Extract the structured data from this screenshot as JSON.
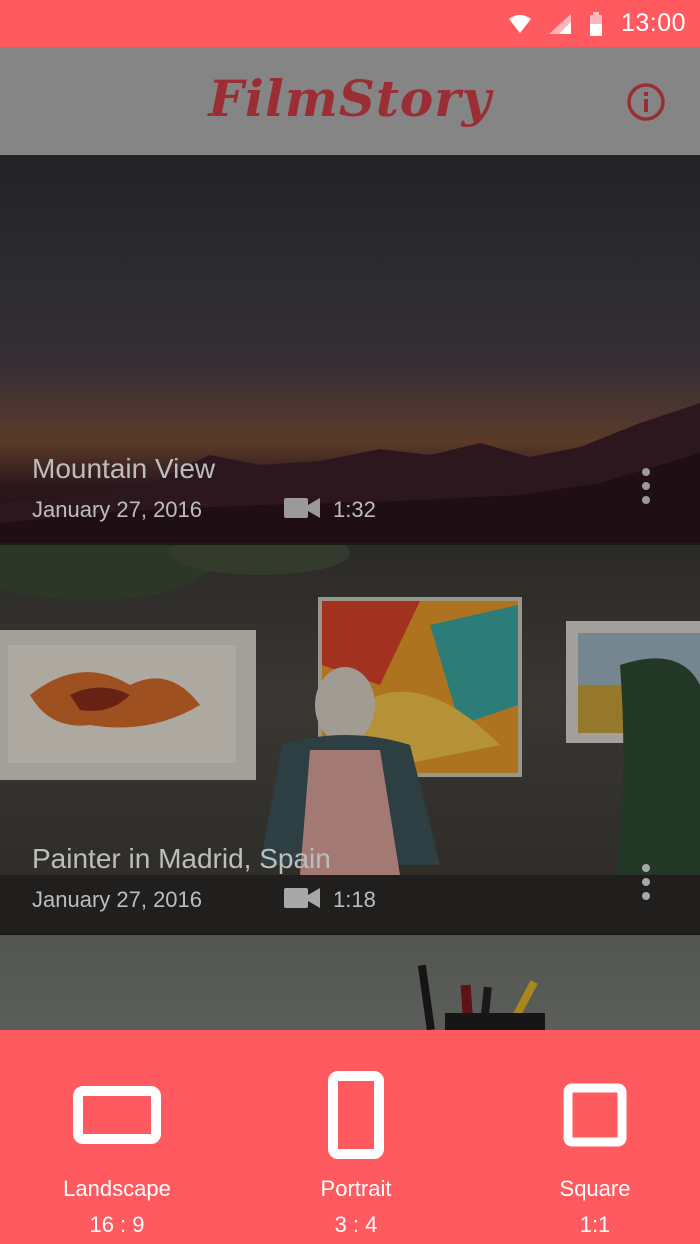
{
  "status_bar": {
    "time": "13:00"
  },
  "app_bar": {
    "title": "FilmStory",
    "info_icon": "info-icon"
  },
  "films": [
    {
      "title": "Mountain View",
      "date": "January 27, 2016",
      "duration": "1:32"
    },
    {
      "title": "Painter in Madrid, Spain",
      "date": "January 27, 2016",
      "duration": "1:18"
    }
  ],
  "formats": [
    {
      "label": "Landscape",
      "ratio": "16 : 9",
      "icon": "landscape-icon"
    },
    {
      "label": "Portrait",
      "ratio": "3 : 4",
      "icon": "portrait-icon"
    },
    {
      "label": "Square",
      "ratio": "1:1",
      "icon": "square-icon"
    }
  ],
  "colors": {
    "accent": "#ff5a5f",
    "title_red": "#9b2d34",
    "app_bar_gray": "#858585"
  }
}
